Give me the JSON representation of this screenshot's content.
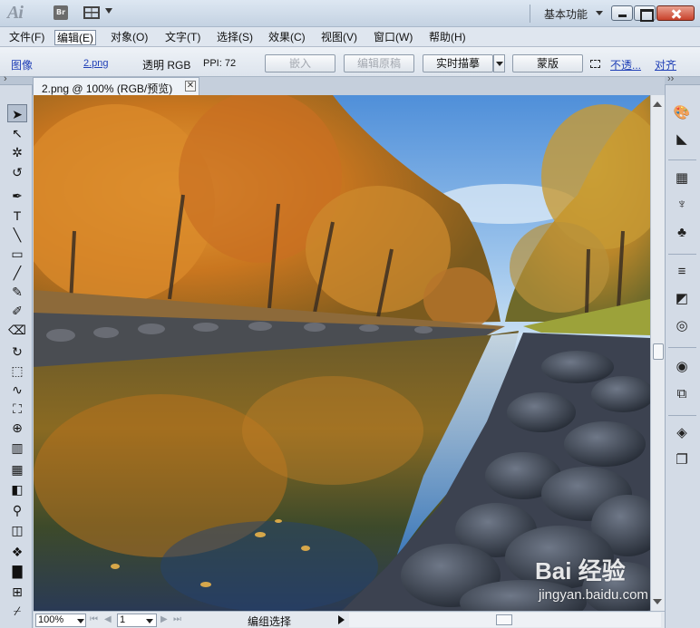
{
  "app": {
    "logo": "Ai",
    "bridge_button": "Br",
    "workspace": "基本功能"
  },
  "menu": [
    {
      "label": "文件(F)"
    },
    {
      "label": "编辑(E)"
    },
    {
      "label": "对象(O)"
    },
    {
      "label": "文字(T)"
    },
    {
      "label": "选择(S)"
    },
    {
      "label": "效果(C)"
    },
    {
      "label": "视图(V)"
    },
    {
      "label": "窗口(W)"
    },
    {
      "label": "帮助(H)"
    }
  ],
  "control_bar": {
    "object_type": "图像",
    "file_name": "2.png",
    "transparency": "透明 RGB",
    "ppi": "PPI: 72",
    "embed_button": "嵌入",
    "edit_original_button": "编辑原稿",
    "live_trace_button": "实时描摹",
    "mask_button": "蒙版",
    "opacity_link": "不透...",
    "align_link": "对齐"
  },
  "document": {
    "tab_title": "2.png @ 100% (RGB/预览)",
    "close_glyph": "✕"
  },
  "status_bar": {
    "zoom": "100%",
    "artboard": "1",
    "status": "编组选择"
  },
  "watermark": {
    "logo_text": "Bai 经验",
    "url": "jingyan.baidu.com"
  },
  "tools": [
    {
      "name": "selection-tool",
      "glyph": "➤",
      "selected": true
    },
    {
      "name": "direct-selection-tool",
      "glyph": "↖"
    },
    {
      "name": "magic-wand-tool",
      "glyph": "✲"
    },
    {
      "name": "lasso-tool",
      "glyph": "↺"
    },
    {
      "name": "pen-tool",
      "glyph": "✒"
    },
    {
      "name": "type-tool",
      "glyph": "T"
    },
    {
      "name": "line-segment-tool",
      "glyph": "╲"
    },
    {
      "name": "rectangle-tool",
      "glyph": "▭"
    },
    {
      "name": "paintbrush-tool",
      "glyph": "╱"
    },
    {
      "name": "pencil-tool",
      "glyph": "✎"
    },
    {
      "name": "blob-brush-tool",
      "glyph": "✐"
    },
    {
      "name": "eraser-tool",
      "glyph": "⌫"
    },
    {
      "name": "rotate-tool",
      "glyph": "↻"
    },
    {
      "name": "scale-tool",
      "glyph": "⬚"
    },
    {
      "name": "warp-tool",
      "glyph": "∿"
    },
    {
      "name": "free-transform-tool",
      "glyph": "⛶"
    },
    {
      "name": "shape-builder-tool",
      "glyph": "⊕"
    },
    {
      "name": "graph-tool",
      "glyph": "▥"
    },
    {
      "name": "mesh-tool",
      "glyph": "▦"
    },
    {
      "name": "gradient-tool",
      "glyph": "◧"
    },
    {
      "name": "eyedropper-tool",
      "glyph": "⚲"
    },
    {
      "name": "blend-tool",
      "glyph": "◫"
    },
    {
      "name": "symbol-sprayer-tool",
      "glyph": "❖"
    },
    {
      "name": "column-graph-tool",
      "glyph": "▇"
    },
    {
      "name": "artboard-tool",
      "glyph": "⊞"
    },
    {
      "name": "slice-tool",
      "glyph": "⌿"
    }
  ],
  "panels": [
    {
      "name": "color-panel-icon",
      "glyph": "🎨"
    },
    {
      "name": "color-guide-panel-icon",
      "glyph": "◣"
    },
    {
      "name": "swatches-panel-icon",
      "glyph": "▦"
    },
    {
      "name": "brushes-panel-icon",
      "glyph": "♆"
    },
    {
      "name": "symbols-panel-icon",
      "glyph": "♣"
    },
    {
      "name": "stroke-panel-icon",
      "glyph": "≡"
    },
    {
      "name": "gradient-panel-icon",
      "glyph": "◩"
    },
    {
      "name": "transparency-panel-icon",
      "glyph": "◎"
    },
    {
      "name": "appearance-panel-icon",
      "glyph": "◉"
    },
    {
      "name": "graphic-styles-panel-icon",
      "glyph": "⧉"
    },
    {
      "name": "layers-panel-icon",
      "glyph": "◈"
    },
    {
      "name": "artboards-panel-icon",
      "glyph": "❐"
    }
  ]
}
